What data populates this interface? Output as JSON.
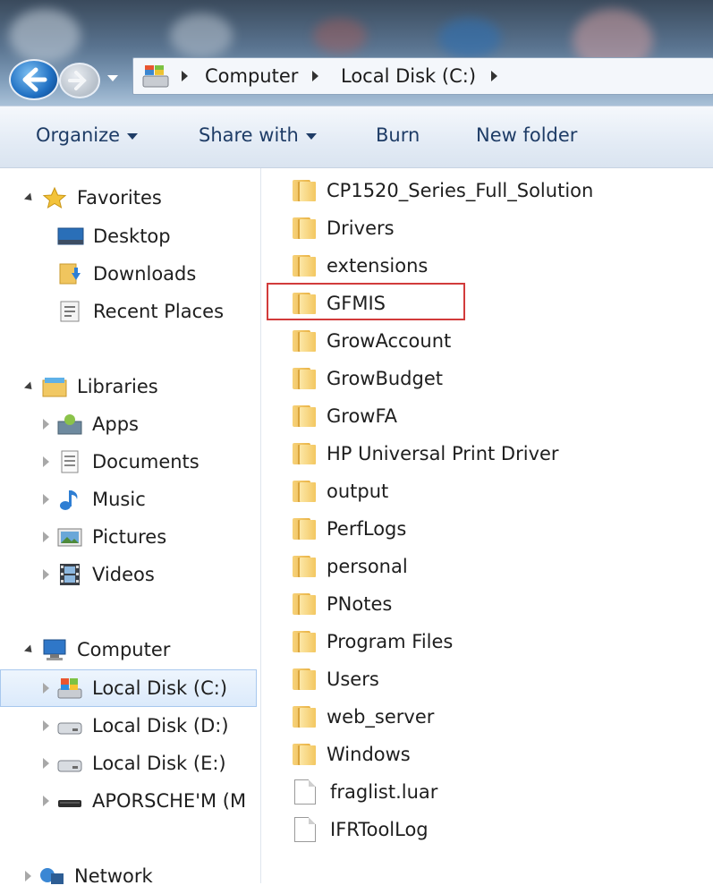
{
  "window": {
    "breadcrumb": [
      "Computer",
      "Local Disk (C:)"
    ]
  },
  "toolbar": {
    "organize": "Organize",
    "share_with": "Share with",
    "burn": "Burn",
    "new_folder": "New folder"
  },
  "nav": {
    "favorites": {
      "label": "Favorites",
      "items": [
        "Desktop",
        "Downloads",
        "Recent Places"
      ]
    },
    "libraries": {
      "label": "Libraries",
      "items": [
        "Apps",
        "Documents",
        "Music",
        "Pictures",
        "Videos"
      ]
    },
    "computer": {
      "label": "Computer",
      "items": [
        "Local Disk (C:)",
        "Local Disk (D:)",
        "Local Disk (E:)",
        "APORSCHE'M (M"
      ],
      "selected": "Local Disk (C:)"
    },
    "network": {
      "label": "Network"
    }
  },
  "files": {
    "folders": [
      "CP1520_Series_Full_Solution",
      "Drivers",
      "extensions",
      "GFMIS",
      "GrowAccount",
      "GrowBudget",
      "GrowFA",
      "HP Universal Print Driver",
      "output",
      "PerfLogs",
      "personal",
      "PNotes",
      "Program Files",
      "Users",
      "web_server",
      "Windows"
    ],
    "documents": [
      "fraglist.luar",
      "IFRToolLog"
    ],
    "highlighted": "GFMIS"
  },
  "colors": {
    "highlight_border": "#d23b3b",
    "selection": "#dbeafb",
    "toolbar_text": "#1e3c66"
  }
}
